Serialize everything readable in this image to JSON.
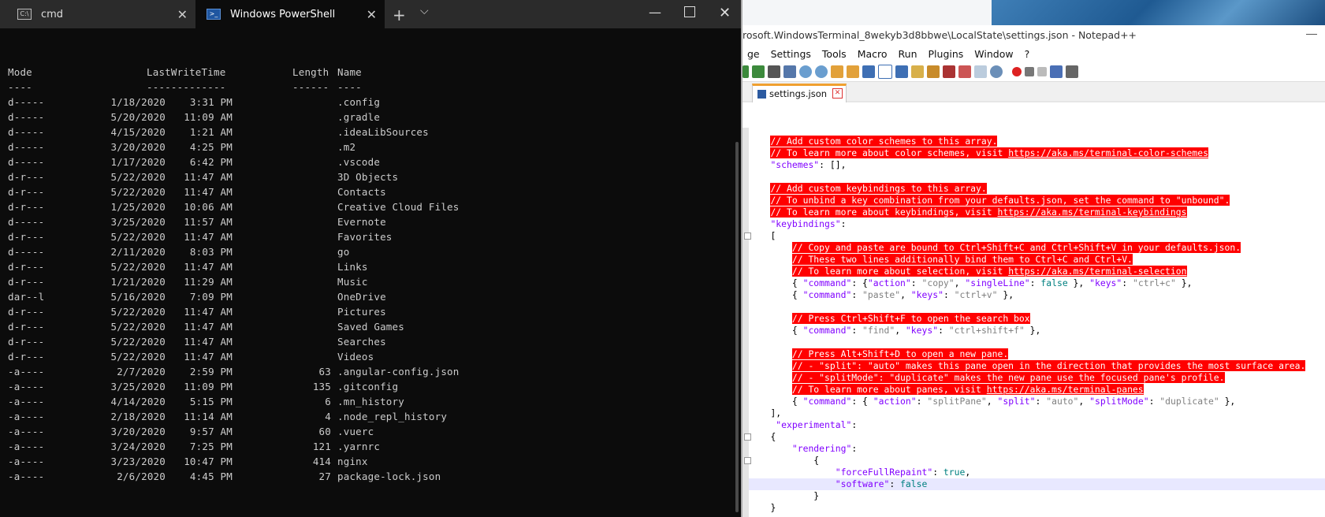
{
  "terminal": {
    "tabs": [
      {
        "label": "cmd",
        "icon": "cmd-icon"
      },
      {
        "label": "Windows PowerShell",
        "icon": "powershell-icon"
      }
    ],
    "new_tab": "+",
    "headers": {
      "mode": "Mode",
      "time": "LastWriteTime",
      "length": "Length",
      "name": "Name"
    },
    "dashes": {
      "mode": "----",
      "time": "-------------",
      "length": "------",
      "name": "----"
    },
    "rows": [
      {
        "mode": "d-----",
        "date": "1/18/2020",
        "time": "3:31 PM",
        "length": "",
        "name": ".config"
      },
      {
        "mode": "d-----",
        "date": "5/20/2020",
        "time": "11:09 AM",
        "length": "",
        "name": ".gradle"
      },
      {
        "mode": "d-----",
        "date": "4/15/2020",
        "time": "1:21 AM",
        "length": "",
        "name": ".ideaLibSources"
      },
      {
        "mode": "d-----",
        "date": "3/20/2020",
        "time": "4:25 PM",
        "length": "",
        "name": ".m2"
      },
      {
        "mode": "d-----",
        "date": "1/17/2020",
        "time": "6:42 PM",
        "length": "",
        "name": ".vscode"
      },
      {
        "mode": "d-r---",
        "date": "5/22/2020",
        "time": "11:47 AM",
        "length": "",
        "name": "3D Objects"
      },
      {
        "mode": "d-r---",
        "date": "5/22/2020",
        "time": "11:47 AM",
        "length": "",
        "name": "Contacts"
      },
      {
        "mode": "d-r---",
        "date": "1/25/2020",
        "time": "10:06 AM",
        "length": "",
        "name": "Creative Cloud Files"
      },
      {
        "mode": "d-----",
        "date": "3/25/2020",
        "time": "11:57 AM",
        "length": "",
        "name": "Evernote"
      },
      {
        "mode": "d-r---",
        "date": "5/22/2020",
        "time": "11:47 AM",
        "length": "",
        "name": "Favorites"
      },
      {
        "mode": "d-----",
        "date": "2/11/2020",
        "time": "8:03 PM",
        "length": "",
        "name": "go"
      },
      {
        "mode": "d-r---",
        "date": "5/22/2020",
        "time": "11:47 AM",
        "length": "",
        "name": "Links"
      },
      {
        "mode": "d-r---",
        "date": "1/21/2020",
        "time": "11:29 AM",
        "length": "",
        "name": "Music"
      },
      {
        "mode": "dar--l",
        "date": "5/16/2020",
        "time": "7:09 PM",
        "length": "",
        "name": "OneDrive"
      },
      {
        "mode": "d-r---",
        "date": "5/22/2020",
        "time": "11:47 AM",
        "length": "",
        "name": "Pictures"
      },
      {
        "mode": "d-r---",
        "date": "5/22/2020",
        "time": "11:47 AM",
        "length": "",
        "name": "Saved Games"
      },
      {
        "mode": "d-r---",
        "date": "5/22/2020",
        "time": "11:47 AM",
        "length": "",
        "name": "Searches"
      },
      {
        "mode": "d-r---",
        "date": "5/22/2020",
        "time": "11:47 AM",
        "length": "",
        "name": "Videos"
      },
      {
        "mode": "-a----",
        "date": "2/7/2020",
        "time": "2:59 PM",
        "length": "63",
        "name": ".angular-config.json"
      },
      {
        "mode": "-a----",
        "date": "3/25/2020",
        "time": "11:09 PM",
        "length": "135",
        "name": ".gitconfig"
      },
      {
        "mode": "-a----",
        "date": "4/14/2020",
        "time": "5:15 PM",
        "length": "6",
        "name": ".mn_history"
      },
      {
        "mode": "-a----",
        "date": "2/18/2020",
        "time": "11:14 AM",
        "length": "4",
        "name": ".node_repl_history"
      },
      {
        "mode": "-a----",
        "date": "3/20/2020",
        "time": "9:57 AM",
        "length": "60",
        "name": ".vuerc"
      },
      {
        "mode": "-a----",
        "date": "3/24/2020",
        "time": "7:25 PM",
        "length": "121",
        "name": ".yarnrc"
      },
      {
        "mode": "-a----",
        "date": "3/23/2020",
        "time": "10:47 PM",
        "length": "414",
        "name": "nginx"
      },
      {
        "mode": "-a----",
        "date": "2/6/2020",
        "time": "4:45 PM",
        "length": "27",
        "name": "package-lock.json"
      }
    ]
  },
  "notepad": {
    "title": "rosoft.WindowsTerminal_8wekyb3d8bbwe\\LocalState\\settings.json - Notepad++",
    "menu": [
      "ge",
      "Settings",
      "Tools",
      "Macro",
      "Run",
      "Plugins",
      "Window",
      "?"
    ],
    "tab_label": "settings.json",
    "lines": [
      {
        "indent": "    ",
        "parts": [
          {
            "t": "// Add custom color schemes to this array.",
            "c": "cmt"
          }
        ]
      },
      {
        "indent": "    ",
        "parts": [
          {
            "t": "// To learn more about color schemes, visit ",
            "c": "cmt"
          },
          {
            "t": "https://aka.ms/terminal-color-schemes",
            "c": "cmt-link"
          }
        ]
      },
      {
        "indent": "    ",
        "parts": [
          {
            "t": "\"schemes\"",
            "c": "key"
          },
          {
            "t": ": [],",
            "c": ""
          }
        ]
      },
      {
        "indent": "",
        "parts": []
      },
      {
        "indent": "    ",
        "parts": [
          {
            "t": "// Add custom keybindings to this array.",
            "c": "cmt"
          }
        ]
      },
      {
        "indent": "    ",
        "parts": [
          {
            "t": "// To unbind a key combination from your defaults.json, set the command to \"unbound\".",
            "c": "cmt"
          }
        ]
      },
      {
        "indent": "    ",
        "parts": [
          {
            "t": "// To learn more about keybindings, visit ",
            "c": "cmt"
          },
          {
            "t": "https://aka.ms/terminal-keybindings",
            "c": "cmt-link"
          }
        ]
      },
      {
        "indent": "    ",
        "parts": [
          {
            "t": "\"keybindings\"",
            "c": "key"
          },
          {
            "t": ":",
            "c": ""
          }
        ]
      },
      {
        "indent": "    ",
        "parts": [
          {
            "t": "[",
            "c": ""
          }
        ]
      },
      {
        "indent": "        ",
        "parts": [
          {
            "t": "// Copy and paste are bound to Ctrl+Shift+C and Ctrl+Shift+V in your defaults.json.",
            "c": "cmt"
          }
        ]
      },
      {
        "indent": "        ",
        "parts": [
          {
            "t": "// These two lines additionally bind them to Ctrl+C and Ctrl+V.",
            "c": "cmt"
          }
        ]
      },
      {
        "indent": "        ",
        "parts": [
          {
            "t": "// To learn more about selection, visit ",
            "c": "cmt"
          },
          {
            "t": "https://aka.ms/terminal-selection",
            "c": "cmt-link"
          }
        ]
      },
      {
        "indent": "        ",
        "parts": [
          {
            "t": "{ ",
            "c": ""
          },
          {
            "t": "\"command\"",
            "c": "key"
          },
          {
            "t": ": {",
            "c": ""
          },
          {
            "t": "\"action\"",
            "c": "key"
          },
          {
            "t": ": ",
            "c": ""
          },
          {
            "t": "\"copy\"",
            "c": "str"
          },
          {
            "t": ", ",
            "c": ""
          },
          {
            "t": "\"singleLine\"",
            "c": "key"
          },
          {
            "t": ": ",
            "c": ""
          },
          {
            "t": "false",
            "c": "bool"
          },
          {
            "t": " }, ",
            "c": ""
          },
          {
            "t": "\"keys\"",
            "c": "key"
          },
          {
            "t": ": ",
            "c": ""
          },
          {
            "t": "\"ctrl+c\"",
            "c": "str"
          },
          {
            "t": " },",
            "c": ""
          }
        ]
      },
      {
        "indent": "        ",
        "parts": [
          {
            "t": "{ ",
            "c": ""
          },
          {
            "t": "\"command\"",
            "c": "key"
          },
          {
            "t": ": ",
            "c": ""
          },
          {
            "t": "\"paste\"",
            "c": "str"
          },
          {
            "t": ", ",
            "c": ""
          },
          {
            "t": "\"keys\"",
            "c": "key"
          },
          {
            "t": ": ",
            "c": ""
          },
          {
            "t": "\"ctrl+v\"",
            "c": "str"
          },
          {
            "t": " },",
            "c": ""
          }
        ]
      },
      {
        "indent": "",
        "parts": []
      },
      {
        "indent": "        ",
        "parts": [
          {
            "t": "// Press Ctrl+Shift+F to open the search box",
            "c": "cmt"
          }
        ]
      },
      {
        "indent": "        ",
        "parts": [
          {
            "t": "{ ",
            "c": ""
          },
          {
            "t": "\"command\"",
            "c": "key"
          },
          {
            "t": ": ",
            "c": ""
          },
          {
            "t": "\"find\"",
            "c": "str"
          },
          {
            "t": ", ",
            "c": ""
          },
          {
            "t": "\"keys\"",
            "c": "key"
          },
          {
            "t": ": ",
            "c": ""
          },
          {
            "t": "\"ctrl+shift+f\"",
            "c": "str"
          },
          {
            "t": " },",
            "c": ""
          }
        ]
      },
      {
        "indent": "",
        "parts": []
      },
      {
        "indent": "        ",
        "parts": [
          {
            "t": "// Press Alt+Shift+D to open a new pane.",
            "c": "cmt"
          }
        ]
      },
      {
        "indent": "        ",
        "parts": [
          {
            "t": "// - \"split\": \"auto\" makes this pane open in the direction that provides the most surface area.",
            "c": "cmt"
          }
        ]
      },
      {
        "indent": "        ",
        "parts": [
          {
            "t": "// - \"splitMode\": \"duplicate\" makes the new pane use the focused pane's profile.",
            "c": "cmt"
          }
        ]
      },
      {
        "indent": "        ",
        "parts": [
          {
            "t": "// To learn more about panes, visit ",
            "c": "cmt"
          },
          {
            "t": "https://aka.ms/terminal-panes",
            "c": "cmt-link"
          }
        ]
      },
      {
        "indent": "        ",
        "parts": [
          {
            "t": "{ ",
            "c": ""
          },
          {
            "t": "\"command\"",
            "c": "key"
          },
          {
            "t": ": { ",
            "c": ""
          },
          {
            "t": "\"action\"",
            "c": "key"
          },
          {
            "t": ": ",
            "c": ""
          },
          {
            "t": "\"splitPane\"",
            "c": "str"
          },
          {
            "t": ", ",
            "c": ""
          },
          {
            "t": "\"split\"",
            "c": "key"
          },
          {
            "t": ": ",
            "c": ""
          },
          {
            "t": "\"auto\"",
            "c": "str"
          },
          {
            "t": ", ",
            "c": ""
          },
          {
            "t": "\"splitMode\"",
            "c": "key"
          },
          {
            "t": ": ",
            "c": ""
          },
          {
            "t": "\"duplicate\"",
            "c": "str"
          },
          {
            "t": " },",
            "c": ""
          }
        ]
      },
      {
        "indent": "    ",
        "parts": [
          {
            "t": "],",
            "c": ""
          }
        ]
      },
      {
        "indent": "     ",
        "parts": [
          {
            "t": "\"experimental\"",
            "c": "key"
          },
          {
            "t": ":",
            "c": ""
          }
        ]
      },
      {
        "indent": "    ",
        "parts": [
          {
            "t": "{",
            "c": ""
          }
        ]
      },
      {
        "indent": "        ",
        "parts": [
          {
            "t": "\"rendering\"",
            "c": "key"
          },
          {
            "t": ":",
            "c": ""
          }
        ]
      },
      {
        "indent": "            ",
        "parts": [
          {
            "t": "{",
            "c": ""
          }
        ]
      },
      {
        "indent": "                ",
        "parts": [
          {
            "t": "\"forceFullRepaint\"",
            "c": "key"
          },
          {
            "t": ": ",
            "c": ""
          },
          {
            "t": "true",
            "c": "bool"
          },
          {
            "t": ",",
            "c": ""
          }
        ]
      },
      {
        "indent": "                ",
        "parts": [
          {
            "t": "\"software\"",
            "c": "key"
          },
          {
            "t": ": ",
            "c": ""
          },
          {
            "t": "false",
            "c": "bool"
          }
        ],
        "current": true
      },
      {
        "indent": "            ",
        "parts": [
          {
            "t": "}",
            "c": ""
          }
        ]
      },
      {
        "indent": "    ",
        "parts": [
          {
            "t": "}",
            "c": ""
          }
        ]
      }
    ]
  }
}
